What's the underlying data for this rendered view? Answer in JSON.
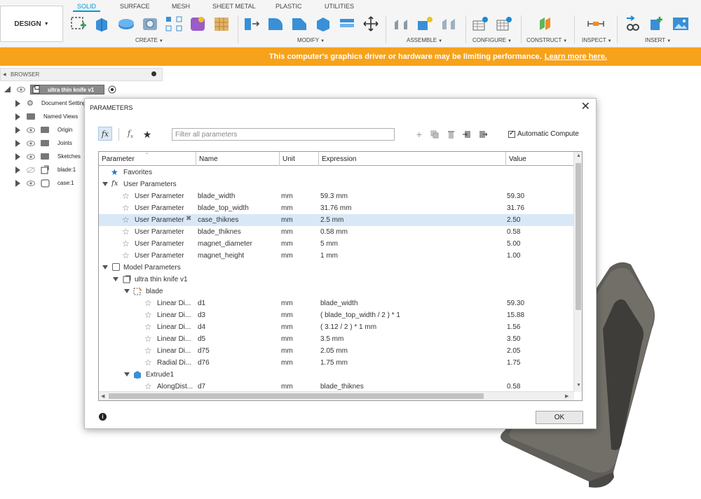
{
  "toolbar": {
    "workspace": "DESIGN",
    "tabs": [
      "SOLID",
      "SURFACE",
      "MESH",
      "SHEET METAL",
      "PLASTIC",
      "UTILITIES"
    ],
    "active_tab": "SOLID",
    "groups": [
      "CREATE",
      "MODIFY",
      "ASSEMBLE",
      "CONFIGURE",
      "CONSTRUCT",
      "INSPECT",
      "INSERT"
    ],
    "accent_color": "#0696d7"
  },
  "warning": {
    "message": "This computer's graphics driver or hardware may be limiting performance.",
    "link": "Learn more here.",
    "color": "#f7a21b"
  },
  "browser": {
    "title": "BROWSER",
    "root": "ultra thin knife v1",
    "items": [
      "Document Settings",
      "Named Views",
      "Origin",
      "Joints",
      "Sketches",
      "blade:1",
      "case:1"
    ]
  },
  "dialog": {
    "title": "PARAMETERS",
    "filter_placeholder": "Filter all parameters",
    "auto_compute_label": "Automatic Compute",
    "ok_label": "OK",
    "columns": [
      "Parameter",
      "Name",
      "Unit",
      "Expression",
      "Value"
    ],
    "groups": {
      "favorites": "Favorites",
      "user_parameters": "User Parameters",
      "model_parameters": "Model Parameters",
      "component": "ultra thin knife v1",
      "blade_body": "blade",
      "extrude": "Extrude1"
    },
    "user_rows": [
      {
        "parameter": "User Parameter",
        "name": "blade_width",
        "unit": "mm",
        "expression": "59.3 mm",
        "value": "59.30"
      },
      {
        "parameter": "User Parameter",
        "name": "blade_top_width",
        "unit": "mm",
        "expression": "31.76 mm",
        "value": "31.76"
      },
      {
        "parameter": "User Parameter",
        "name": "case_thiknes",
        "unit": "mm",
        "expression": "2.5 mm",
        "value": "2.50"
      },
      {
        "parameter": "User Parameter",
        "name": "blade_thiknes",
        "unit": "mm",
        "expression": "0.58 mm",
        "value": "0.58"
      },
      {
        "parameter": "User Parameter",
        "name": "magnet_diameter",
        "unit": "mm",
        "expression": "5 mm",
        "value": "5.00"
      },
      {
        "parameter": "User Parameter",
        "name": "magnet_height",
        "unit": "mm",
        "expression": "1 mm",
        "value": "1.00"
      }
    ],
    "blade_rows": [
      {
        "parameter": "Linear Di...",
        "name": "d1",
        "unit": "mm",
        "expression": "blade_width",
        "value": "59.30"
      },
      {
        "parameter": "Linear Di...",
        "name": "d3",
        "unit": "mm",
        "expression": "( blade_top_width / 2 ) * 1",
        "value": "15.88"
      },
      {
        "parameter": "Linear Di...",
        "name": "d4",
        "unit": "mm",
        "expression": "( 3.12 / 2 ) * 1 mm",
        "value": "1.56"
      },
      {
        "parameter": "Linear Di...",
        "name": "d5",
        "unit": "mm",
        "expression": "3.5 mm",
        "value": "3.50"
      },
      {
        "parameter": "Linear Di...",
        "name": "d75",
        "unit": "mm",
        "expression": "2.05 mm",
        "value": "2.05"
      },
      {
        "parameter": "Radial Di...",
        "name": "d76",
        "unit": "mm",
        "expression": "1.75 mm",
        "value": "1.75"
      }
    ],
    "extrude_rows": [
      {
        "parameter": "AlongDist...",
        "name": "d7",
        "unit": "mm",
        "expression": "blade_thiknes",
        "value": "0.58"
      }
    ]
  }
}
